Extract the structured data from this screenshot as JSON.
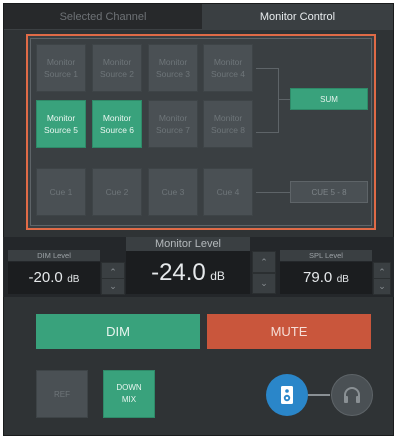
{
  "tabs": {
    "selected_channel": "Selected Channel",
    "monitor_control": "Monitor Control"
  },
  "sources": [
    {
      "label_line1": "Monitor",
      "label_line2": "Source 1",
      "active": false
    },
    {
      "label_line1": "Monitor",
      "label_line2": "Source 2",
      "active": false
    },
    {
      "label_line1": "Monitor",
      "label_line2": "Source 3",
      "active": false
    },
    {
      "label_line1": "Monitor",
      "label_line2": "Source 4",
      "active": false
    },
    {
      "label_line1": "Monitor",
      "label_line2": "Source 5",
      "active": true
    },
    {
      "label_line1": "Monitor",
      "label_line2": "Source 6",
      "active": true
    },
    {
      "label_line1": "Monitor",
      "label_line2": "Source 7",
      "active": false
    },
    {
      "label_line1": "Monitor",
      "label_line2": "Source 8",
      "active": false
    }
  ],
  "cues": [
    "Cue 1",
    "Cue 2",
    "Cue 3",
    "Cue 4"
  ],
  "sum_label": "SUM",
  "cue58_label": "CUE 5 - 8",
  "levels": {
    "dim_label": "DIM Level",
    "dim_value": "-20.0",
    "dim_unit": "dB",
    "monitor_label": "Monitor Level",
    "monitor_value": "-24.0",
    "monitor_unit": "dB",
    "spl_label": "SPL Level",
    "spl_value": "79.0",
    "spl_unit": "dB"
  },
  "buttons": {
    "dim": "DIM",
    "mute": "MUTE",
    "ref": "REF",
    "downmix_line1": "DOWN",
    "downmix_line2": "MIX"
  },
  "icons": {
    "up": "chevron-up",
    "down": "chevron-down",
    "speaker": "speaker-icon",
    "headphones": "headphones-icon"
  },
  "colors": {
    "active_green": "#39a27c",
    "mute_red": "#c9563c",
    "frame_orange": "#e06b47",
    "speaker_blue": "#2a86c9"
  }
}
